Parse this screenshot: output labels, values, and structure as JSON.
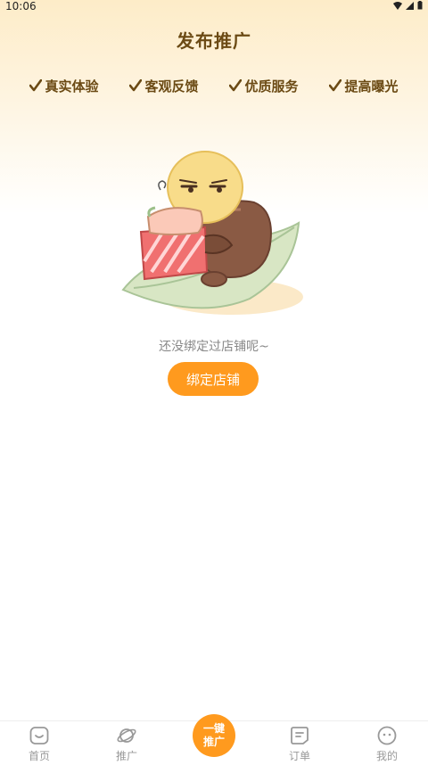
{
  "status_bar": {
    "time": "10:06"
  },
  "header": {
    "title": "发布推广"
  },
  "features": [
    {
      "label": "真实体验"
    },
    {
      "label": "客观反馈"
    },
    {
      "label": "优质服务"
    },
    {
      "label": "提高曝光"
    }
  ],
  "empty_state": {
    "message": "还没绑定过店铺呢~",
    "button_label": "绑定店铺"
  },
  "tabbar": {
    "items": [
      {
        "label": "首页",
        "icon": "home-icon"
      },
      {
        "label": "推广",
        "icon": "planet-icon"
      },
      {
        "label": "一键推广",
        "icon": ""
      },
      {
        "label": "订单",
        "icon": "order-icon"
      },
      {
        "label": "我的",
        "icon": "profile-icon"
      }
    ],
    "center_label_line1": "一键",
    "center_label_line2": "推广"
  },
  "colors": {
    "accent": "#ff9a1e",
    "title": "#6b4a14",
    "muted": "#888888"
  }
}
